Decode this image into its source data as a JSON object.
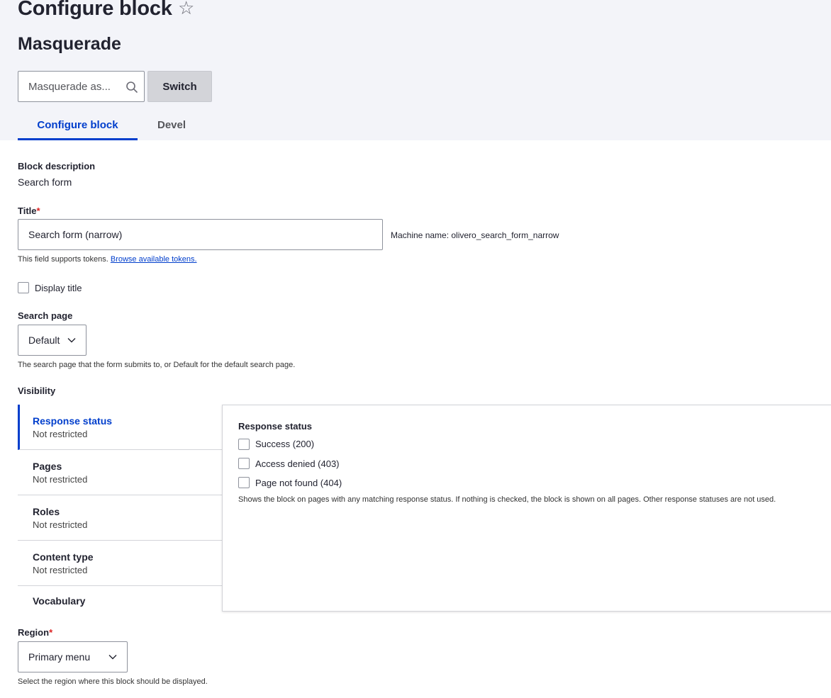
{
  "page": {
    "title": "Configure block",
    "star_icon": "star-outline-icon"
  },
  "masquerade": {
    "heading": "Masquerade",
    "input_placeholder": "Masquerade as...",
    "search_icon": "search-icon",
    "switch_label": "Switch"
  },
  "tabs": [
    {
      "label": "Configure block",
      "active": true
    },
    {
      "label": "Devel",
      "active": false
    }
  ],
  "form": {
    "block_description_label": "Block description",
    "block_description_value": "Search form",
    "title_label": "Title",
    "required_marker": "*",
    "title_value": "Search form (narrow)",
    "machine_name": "Machine name: olivero_search_form_narrow",
    "tokens_help": "This field supports tokens.",
    "tokens_link": "Browse available tokens.",
    "display_title_label": "Display title",
    "search_page_label": "Search page",
    "search_page_value": "Default",
    "search_page_help": "The search page that the form submits to, or Default for the default search page.",
    "visibility_label": "Visibility",
    "region_label": "Region",
    "region_value": "Primary menu",
    "region_help": "Select the region where this block should be displayed."
  },
  "visibility": {
    "tabs": [
      {
        "title": "Response status",
        "summary": "Not restricted",
        "active": true
      },
      {
        "title": "Pages",
        "summary": "Not restricted",
        "active": false
      },
      {
        "title": "Roles",
        "summary": "Not restricted",
        "active": false
      },
      {
        "title": "Content type",
        "summary": "Not restricted",
        "active": false
      },
      {
        "title": "Vocabulary",
        "summary": "",
        "active": false
      }
    ],
    "pane": {
      "heading": "Response status",
      "options": [
        "Success (200)",
        "Access denied (403)",
        "Page not found (404)"
      ],
      "help": "Shows the block on pages with any matching response status. If nothing is checked, the block is shown on all pages. Other response statuses are not used."
    }
  },
  "colors": {
    "accent": "#003ecc",
    "required": "#dc2323",
    "header_bg": "#f3f4f9"
  }
}
